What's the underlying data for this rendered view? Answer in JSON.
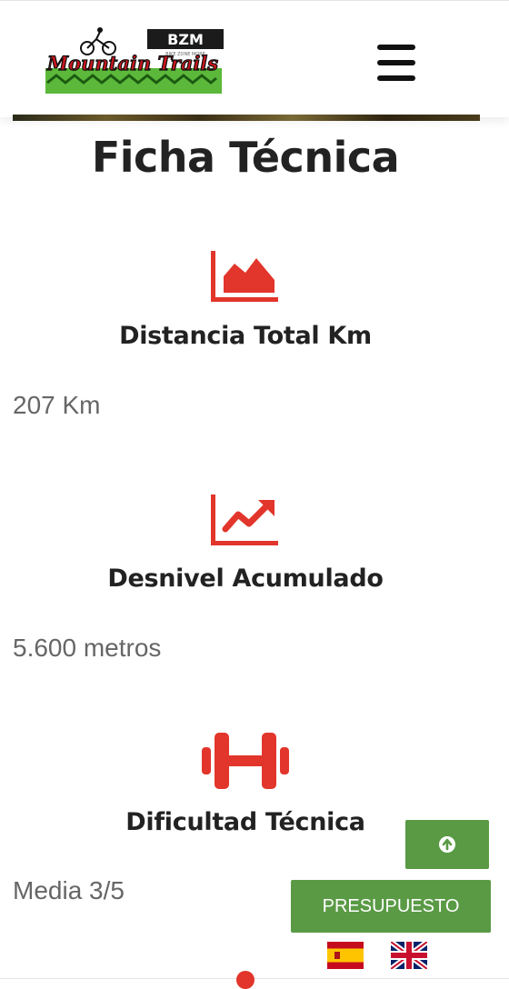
{
  "header": {
    "logo": {
      "brand_badge": "BZM",
      "brand_sub": "BIKE ZONE MORE",
      "name": "Mountain Trails"
    },
    "menu_icon": "hamburger-menu-icon"
  },
  "page": {
    "title": "Ficha Técnica"
  },
  "stats": [
    {
      "icon": "area-chart-icon",
      "label": "Distancia Total Km",
      "value": "207 Km"
    },
    {
      "icon": "line-chart-icon",
      "label": "Desnivel Acumulado",
      "value": "5.600 metros"
    },
    {
      "icon": "dumbbell-icon",
      "label": "Dificultad Técnica",
      "value": "Media 3/5"
    }
  ],
  "floating": {
    "scroll_top_icon": "arrow-up-circle-icon",
    "budget_label": "PRESUPUESTO"
  },
  "languages": [
    {
      "code": "es",
      "icon": "spain-flag-icon"
    },
    {
      "code": "en",
      "icon": "uk-flag-icon"
    }
  ],
  "colors": {
    "accent_red": "#e2352b",
    "button_green": "#5a9a45",
    "logo_green": "#5cb83a",
    "logo_red": "#c8161d"
  }
}
